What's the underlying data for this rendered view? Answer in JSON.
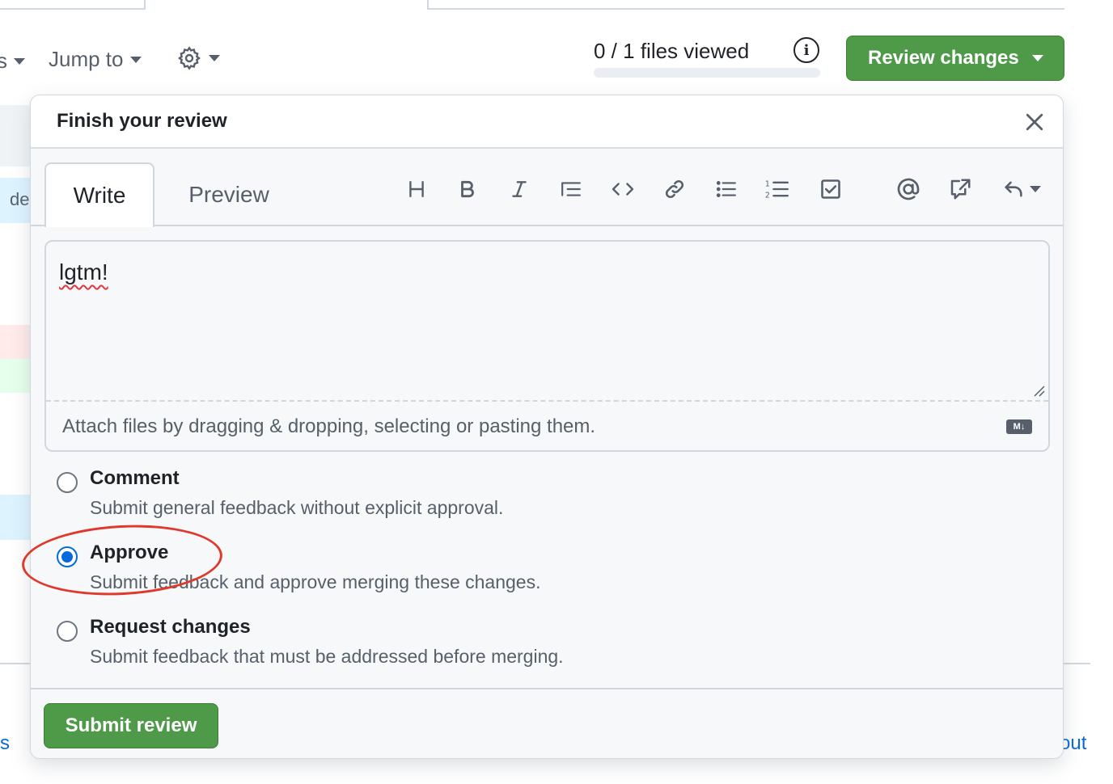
{
  "header": {
    "jump_to_label": "Jump to",
    "files_viewed": "0 / 1 files viewed",
    "files_viewed_progress": 0,
    "review_button_label": "Review changes",
    "partial_left_label": "s"
  },
  "background": {
    "left_fragment": "de",
    "bottom_left_link": "s",
    "bottom_right_link": "out"
  },
  "review_dialog": {
    "title": "Finish your review",
    "tabs": [
      "Write",
      "Preview"
    ],
    "active_tab": "Write",
    "toolbar_icons": [
      "heading-icon",
      "bold-icon",
      "italic-icon",
      "quote-icon",
      "code-icon",
      "link-icon",
      "unordered-list-icon",
      "ordered-list-icon",
      "task-list-icon",
      "mention-icon",
      "reference-icon",
      "saved-replies-icon"
    ],
    "comment_text": "lgtm!",
    "attach_hint": "Attach files by dragging & dropping, selecting or pasting them.",
    "markdown_badge": "M↓",
    "options": [
      {
        "label": "Comment",
        "description": "Submit general feedback without explicit approval.",
        "checked": false
      },
      {
        "label": "Approve",
        "description": "Submit feedback and approve merging these changes.",
        "checked": true
      },
      {
        "label": "Request changes",
        "description": "Submit feedback that must be addressed before merging.",
        "checked": false
      }
    ],
    "submit_label": "Submit review"
  },
  "colors": {
    "primary_green": "#4e9a49",
    "accent_blue": "#0969da",
    "annotation_red": "#e0392b"
  }
}
